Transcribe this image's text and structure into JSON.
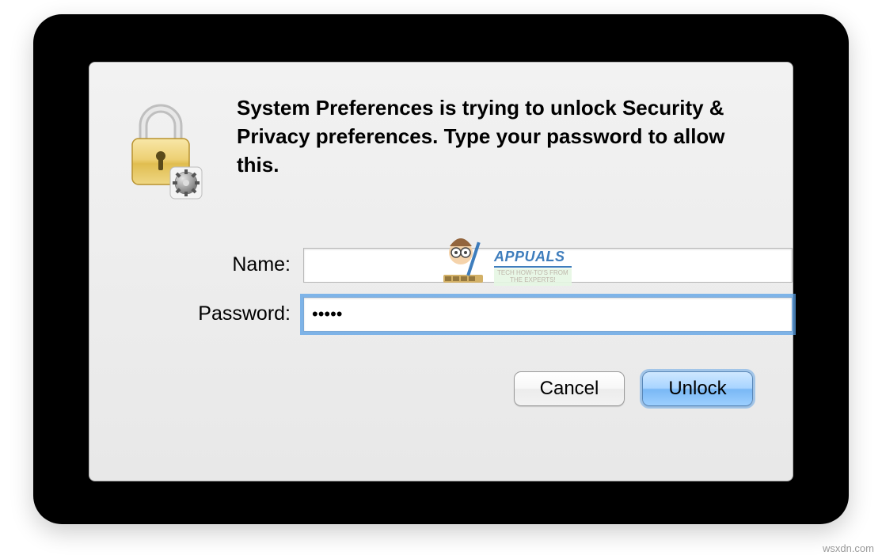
{
  "dialog": {
    "prompt": "System Preferences is trying to unlock Security & Privacy preferences. Type your password to allow this.",
    "name_label": "Name:",
    "name_value": "",
    "password_label": "Password:",
    "password_value": "•••••",
    "cancel_label": "Cancel",
    "unlock_label": "Unlock"
  },
  "watermark": {
    "brand": "APPUALS",
    "tagline1": "TECH HOW-TO'S FROM",
    "tagline2": "THE EXPERTS!",
    "attribution": "wsxdn.com"
  }
}
